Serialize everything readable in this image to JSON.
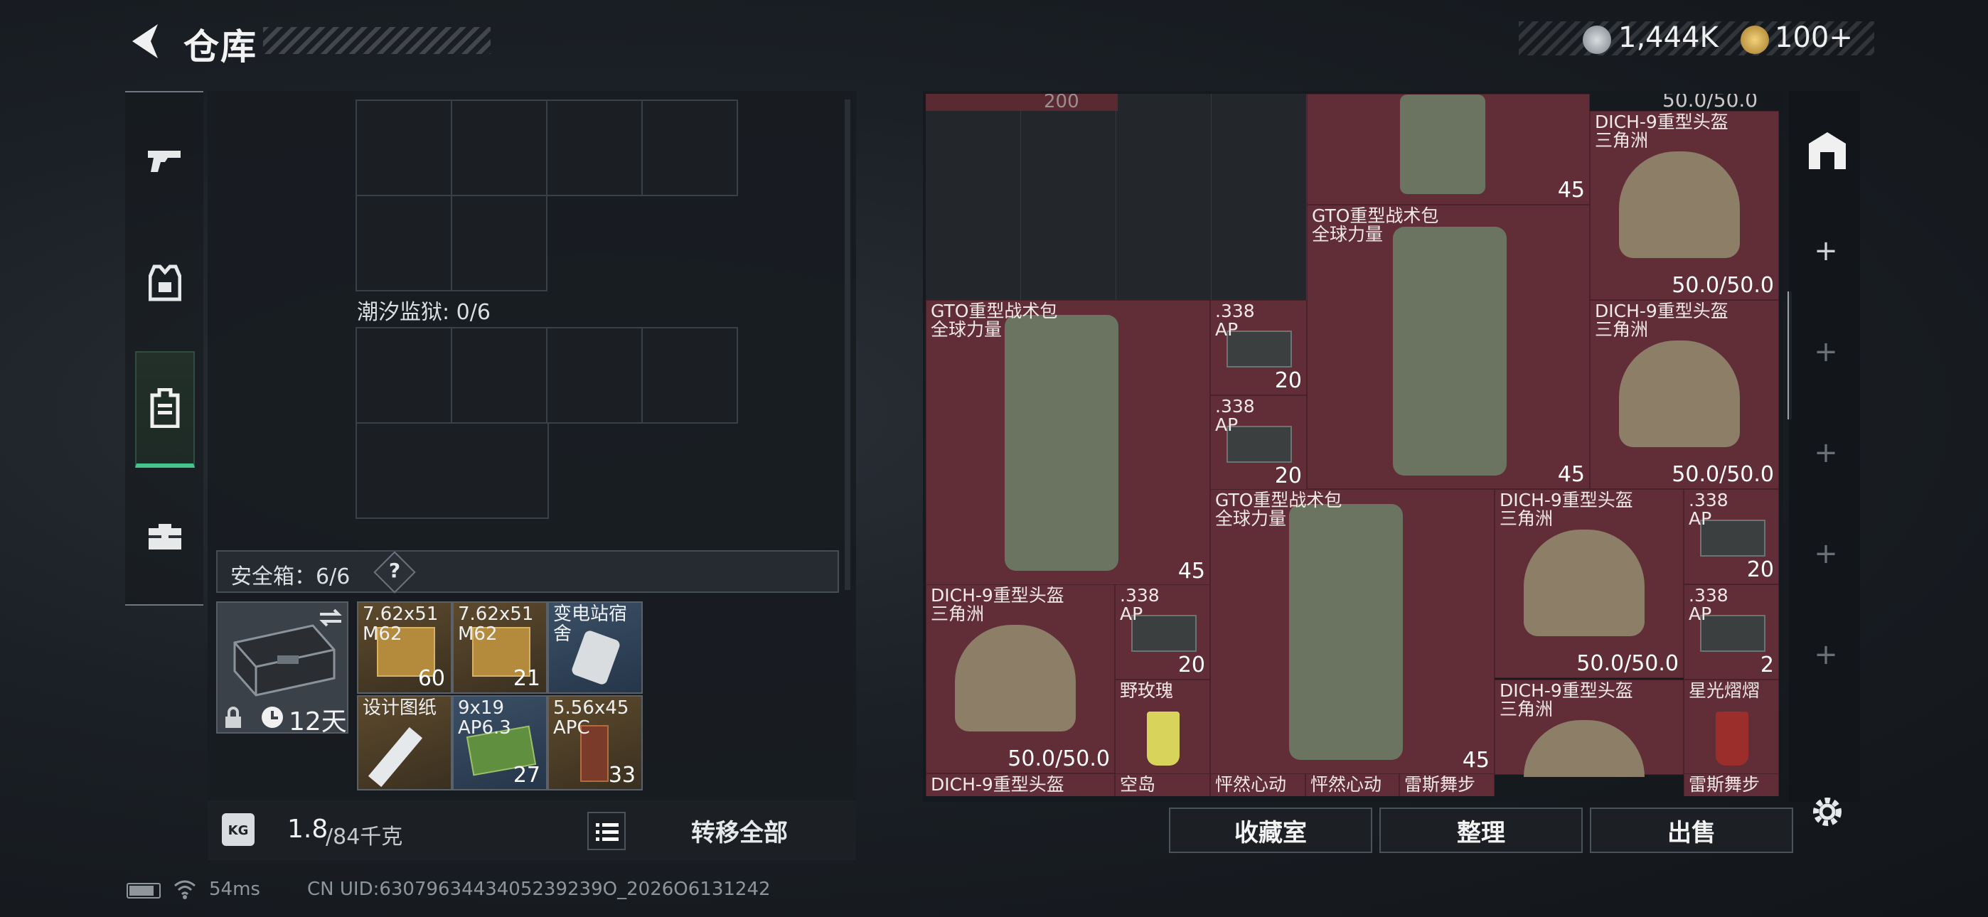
{
  "header": {
    "title": "仓库",
    "back_icon": "back-arrow-icon"
  },
  "currency": [
    {
      "icon": "silver-coin-icon",
      "value": "1,444K"
    },
    {
      "icon": "gold-coin-icon",
      "value": "100+"
    }
  ],
  "tabs": [
    {
      "name": "weapon",
      "icon": "pistol-icon"
    },
    {
      "name": "armor",
      "icon": "vest-icon"
    },
    {
      "name": "backpack",
      "icon": "backpack-icon",
      "active": true
    },
    {
      "name": "case",
      "icon": "toolbox-icon"
    }
  ],
  "left": {
    "container_label": "潮汐监狱: 0/6",
    "safe_label": "安全箱：6/6",
    "help": "?",
    "safe_days": "12天",
    "items": [
      {
        "name": "7.62x51\nM62",
        "qty": "60"
      },
      {
        "name": "7.62x51\nM62",
        "qty": "21"
      },
      {
        "name": "变电站宿舍",
        "qty": ""
      },
      {
        "name": "设计图纸",
        "qty": ""
      },
      {
        "name": "9x19\nAP6.3",
        "qty": "27"
      },
      {
        "name": "5.56x45\nAPC",
        "qty": "33"
      }
    ],
    "weight_value": "1.8",
    "weight_unit": "/84千克",
    "transfer_all": "转移全部"
  },
  "right": {
    "top_partial": {
      "count": "200",
      "durability": "50.0/50.0"
    },
    "items": [
      {
        "name": "",
        "qty": "45"
      },
      {
        "name": "DICH-9重型头盔\n三角洲",
        "qty": "50.0/50.0"
      },
      {
        "name": "GTO重型战术包\n全球力量",
        "qty": "45"
      },
      {
        "name": "GTO重型战术包\n全球力量",
        "qty": "45"
      },
      {
        "name": ".338\nAP",
        "qty": "20"
      },
      {
        "name": "DICH-9重型头盔\n三角洲",
        "qty": "50.0/50.0"
      },
      {
        "name": ".338\nAP",
        "qty": "20"
      },
      {
        "name": "GTO重型战术包\n全球力量",
        "qty": "45"
      },
      {
        "name": "DICH-9重型头盔\n三角洲",
        "qty": "50.0/50.0"
      },
      {
        "name": ".338\nAP",
        "qty": "20"
      },
      {
        "name": "DICH-9重型头盔\n三角洲",
        "qty": "50.0/50.0"
      },
      {
        "name": ".338\nAP",
        "qty": "20"
      },
      {
        "name": ".338\nAP",
        "qty": "2"
      },
      {
        "name": "野玫瑰",
        "qty": ""
      },
      {
        "name": "DICH-9重型头盔\n三角洲",
        "qty": ""
      },
      {
        "name": "星光熠熠",
        "qty": ""
      }
    ],
    "bottom_row": [
      "DICH-9重型头盔",
      "空岛",
      "怦然心动",
      "怦然心动",
      "雷斯舞步",
      "雷斯舞步"
    ],
    "buttons": {
      "vault": "收藏室",
      "sort": "整理",
      "sell": "出售"
    }
  },
  "status": {
    "ping": "54ms",
    "uid": "CN UID:6307963443405239239O_2026O6131242"
  }
}
